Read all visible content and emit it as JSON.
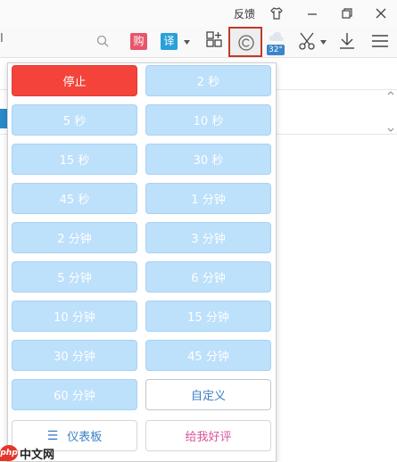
{
  "titlebar": {
    "feedback": "反馈"
  },
  "toolbar": {
    "address_fragment": "I",
    "shop_badge": "购",
    "translate_badge": "译",
    "weather_temp": "32°"
  },
  "panel": {
    "items": [
      {
        "label": "停止",
        "kind": "stop"
      },
      {
        "label": "2 秒",
        "kind": "interval"
      },
      {
        "label": "5 秒",
        "kind": "interval"
      },
      {
        "label": "10 秒",
        "kind": "interval"
      },
      {
        "label": "15 秒",
        "kind": "interval"
      },
      {
        "label": "30 秒",
        "kind": "interval"
      },
      {
        "label": "45 秒",
        "kind": "interval"
      },
      {
        "label": "1 分钟",
        "kind": "interval"
      },
      {
        "label": "2 分钟",
        "kind": "interval"
      },
      {
        "label": "3 分钟",
        "kind": "interval"
      },
      {
        "label": "5 分钟",
        "kind": "interval"
      },
      {
        "label": "6 分钟",
        "kind": "interval"
      },
      {
        "label": "10 分钟",
        "kind": "interval"
      },
      {
        "label": "15 分钟",
        "kind": "interval"
      },
      {
        "label": "30 分钟",
        "kind": "interval"
      },
      {
        "label": "45 分钟",
        "kind": "interval"
      },
      {
        "label": "60 分钟",
        "kind": "interval"
      },
      {
        "label": "自定义",
        "kind": "custom"
      }
    ],
    "dashboard_label": "仪表板",
    "rate_label": "给我好评"
  },
  "watermark": {
    "logo": "php",
    "text": "中文网"
  },
  "colors": {
    "stop": "#f4433a",
    "interval": "#bde0fb",
    "highlight_border": "#c0392b",
    "link_blue": "#3a7fc4",
    "rate_pink": "#d9559a"
  }
}
